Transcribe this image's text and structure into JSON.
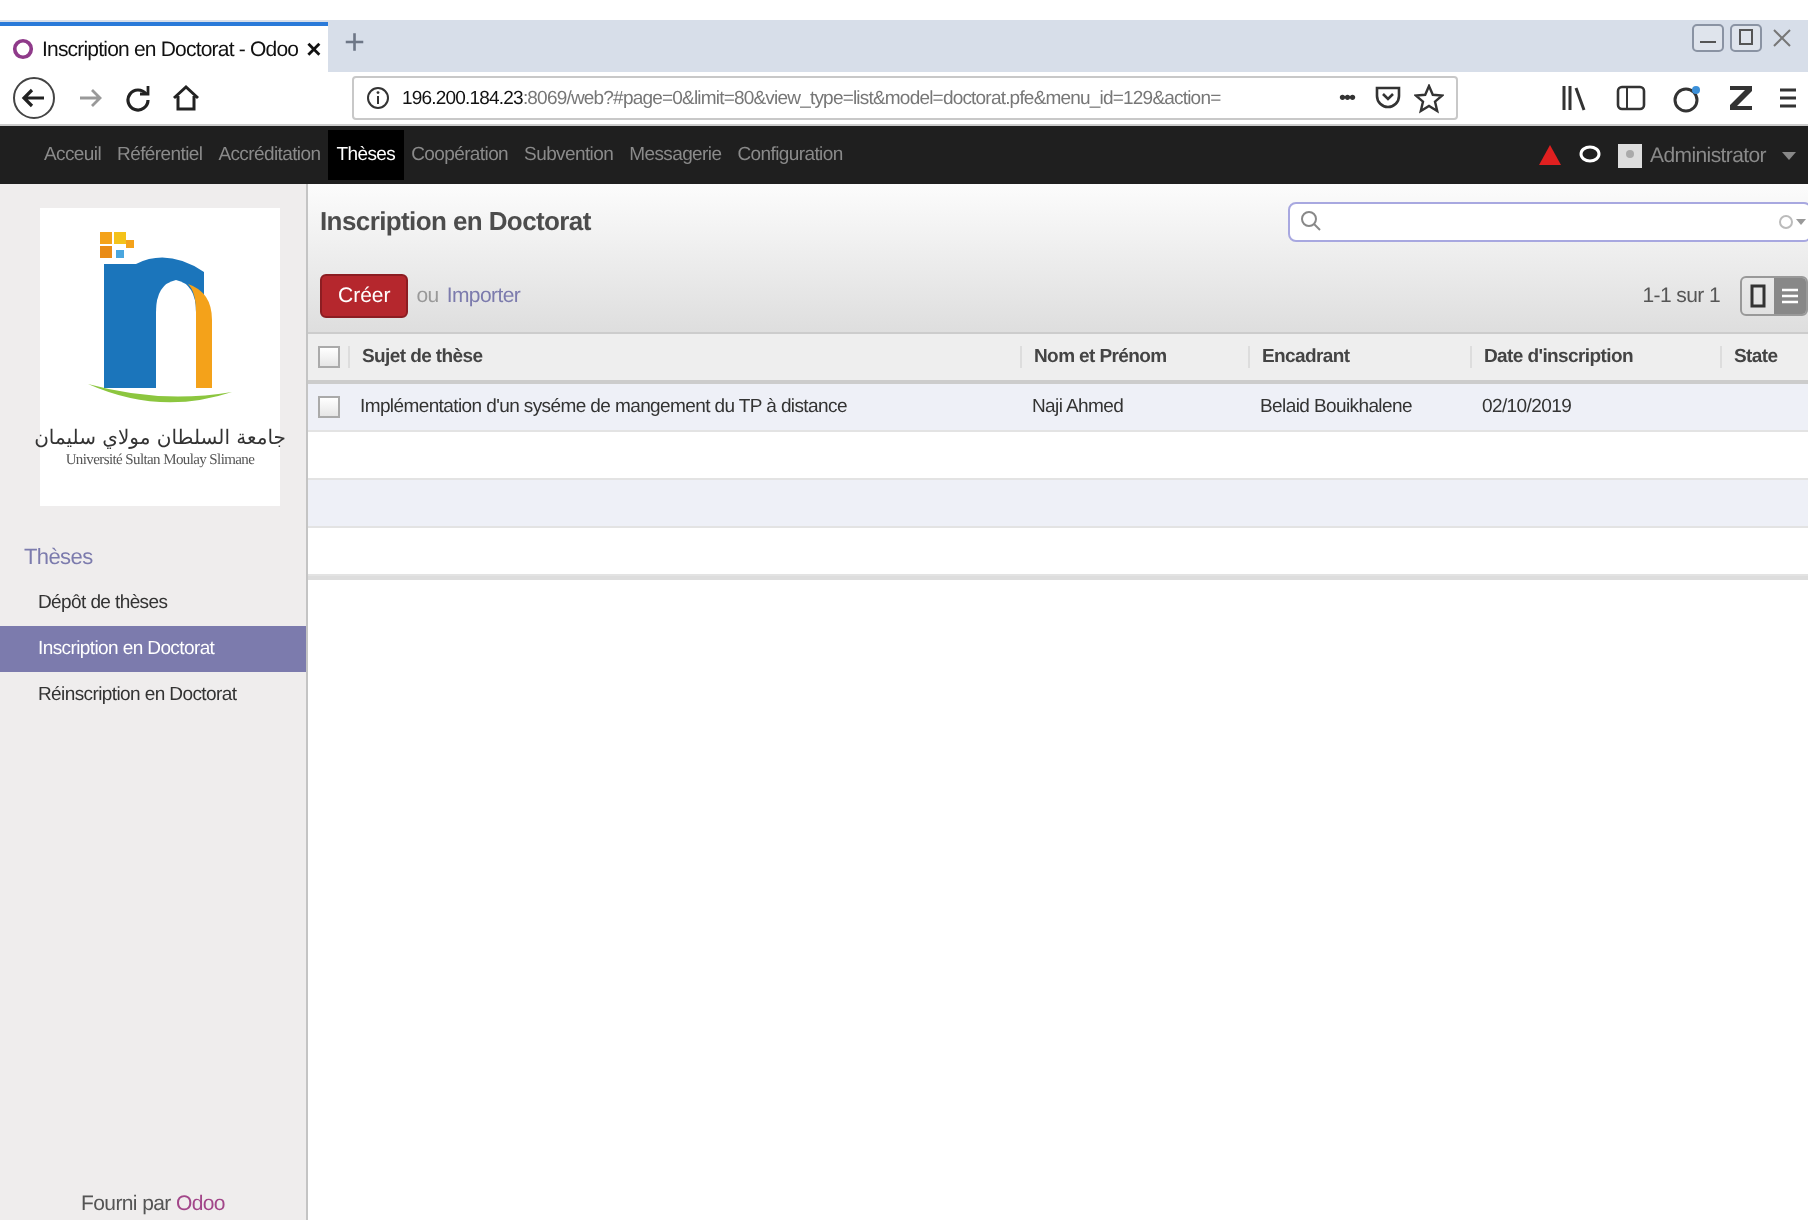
{
  "browser": {
    "tab_title": "Inscription en Doctorat - Odoo",
    "tab_close": "×",
    "new_tab": "+",
    "url_host": "196.200.184.23",
    "url_rest": ":8069/web?#page=0&limit=80&view_type=list&model=doctorat.pfe&menu_id=129&action=",
    "url_more": "•••"
  },
  "navbar": {
    "items": [
      {
        "label": "Acceuil",
        "selected": false
      },
      {
        "label": "Référentiel",
        "selected": false
      },
      {
        "label": "Accréditation",
        "selected": false
      },
      {
        "label": "Thèses",
        "selected": true
      },
      {
        "label": "Coopération",
        "selected": false
      },
      {
        "label": "Subvention",
        "selected": false
      },
      {
        "label": "Messagerie",
        "selected": false
      },
      {
        "label": "Configuration",
        "selected": false
      }
    ],
    "user": "Administrator"
  },
  "logo": {
    "arabic": "جامعة السلطان مولاي سليمان",
    "latin": "Université Sultan Moulay Slimane"
  },
  "sidebar": {
    "section": "Thèses",
    "items": [
      {
        "label": "Dépôt de thèses",
        "selected": false
      },
      {
        "label": "Inscription en Doctorat",
        "selected": true
      },
      {
        "label": "Réinscription en Doctorat",
        "selected": false
      }
    ],
    "footer_text": "Fourni par",
    "footer_link": "Odoo"
  },
  "view": {
    "title": "Inscription en Doctorat",
    "create_button": "Créer",
    "or_text": "ou",
    "import_link": "Importer",
    "pager": "1-1 sur 1"
  },
  "table": {
    "all_checked": false,
    "columns": [
      "Sujet de thèse",
      "Nom et Prénom",
      "Encadrant",
      "Date d'inscription",
      "State"
    ],
    "rows": [
      {
        "checked": false,
        "cells": [
          "Implémentation d'un syséme de mangement du TP à distance",
          "Naji Ahmed",
          "Belaid Bouikhalene",
          "02/10/2019",
          ""
        ]
      }
    ]
  }
}
